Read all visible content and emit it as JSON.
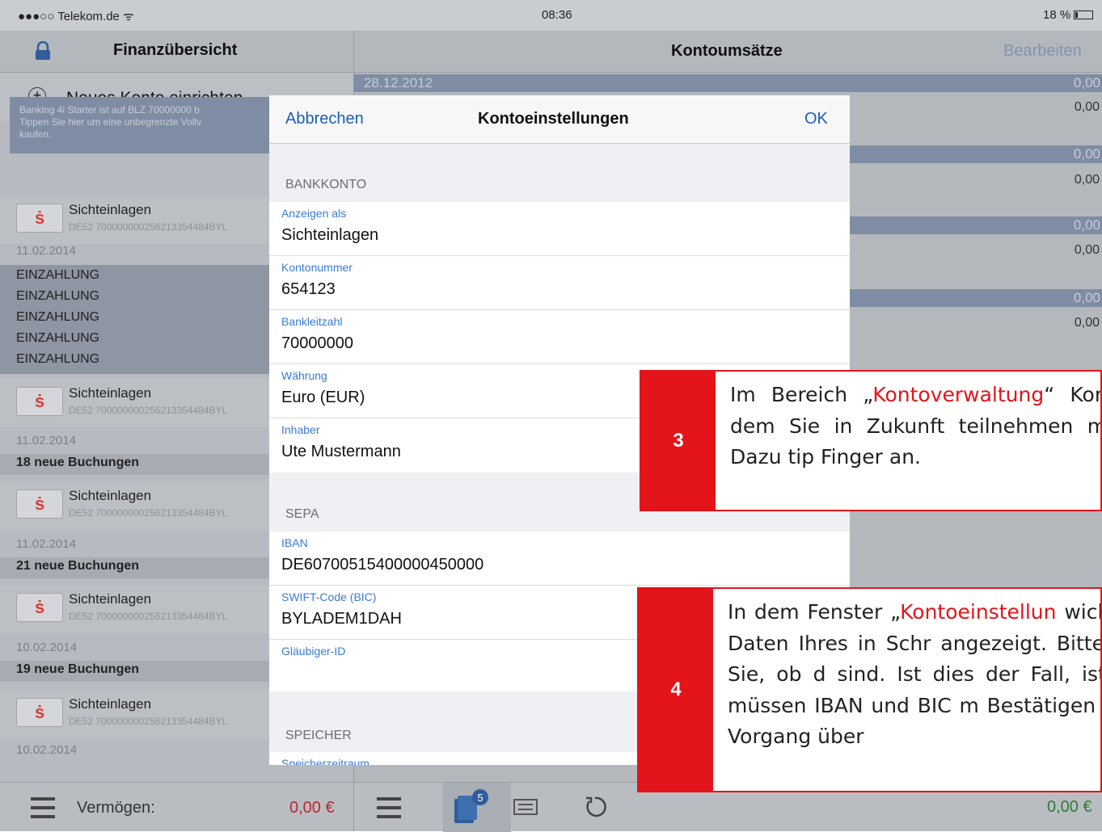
{
  "status_bar": {
    "carrier": "●●●○○ Telekom.de ᯤ",
    "time": "08:36",
    "battery": "18 %"
  },
  "left_pane": {
    "title": "Finanzübersicht",
    "new_account": "Neues Konto einrichten...",
    "banner": {
      "line1": "Banking 4i Starter ist auf BLZ 70000000 b",
      "line2": "Tippen Sie hier um eine unbegrenzte Vollv",
      "line3": "kaufen."
    },
    "accounts": [
      {
        "name": "Sichteinlagen",
        "number": "DE52 700000000256213354484BYL",
        "date": "11.02.2014"
      },
      {
        "name": "Sichteinlagen",
        "number": "DE52 700000000256213354484BYL",
        "date": "11.02.2014"
      },
      {
        "name": "Sichteinlagen",
        "number": "DE52 700000000256213354484BYL",
        "date": "11.02.2014"
      },
      {
        "name": "Sichteinlagen",
        "number": "DE52 700000000256213354484BYL",
        "date": "10.02.2014"
      },
      {
        "name": "Sichteinlagen",
        "number": "DE52 700000000256213354484BYL",
        "date": "10.02.2014"
      }
    ],
    "transactions": [
      "EINZAHLUNG",
      "EINZAHLUNG",
      "EINZAHLUNG",
      "EINZAHLUNG",
      "EINZAHLUNG"
    ],
    "new_bookings": [
      "18 neue Buchungen",
      "21 neue Buchungen",
      "19 neue Buchungen"
    ],
    "footer": {
      "label": "Vermögen:",
      "value": "0,00 €"
    }
  },
  "right_pane": {
    "title": "Kontoumsätze",
    "edit": "Bearbeiten",
    "first_date": "28.12.2012",
    "header_amount": "0,00",
    "amounts": [
      "0,00",
      "0,00",
      "0,00",
      "0,00"
    ],
    "badge": "5",
    "footer_value": "0,00 €"
  },
  "modal": {
    "cancel": "Abbrechen",
    "title": "Kontoeinstellungen",
    "ok": "OK",
    "section_bank": "BANKKONTO",
    "fields_bank": [
      {
        "label": "Anzeigen als",
        "value": "Sichteinlagen"
      },
      {
        "label": "Kontonummer",
        "value": "654123"
      },
      {
        "label": "Bankleitzahl",
        "value": "70000000"
      },
      {
        "label": "Währung",
        "value": "Euro (EUR)"
      },
      {
        "label": "Inhaber",
        "value": "Ute Mustermann"
      }
    ],
    "section_sepa": "SEPA",
    "fields_sepa": [
      {
        "label": "IBAN",
        "value": "DE60700515400000450000"
      },
      {
        "label": "SWIFT-Code (BIC)",
        "value": "BYLADEM1DAH"
      },
      {
        "label": "Gläubiger-ID",
        "value": ""
      }
    ],
    "section_storage": "SPEICHER",
    "storage_partial": "Speicherzeitraum"
  },
  "callouts": [
    {
      "number": "3",
      "text_before": "Im Bereich „",
      "highlight": "Kontoverwaltung",
      "text_after": "“ Konto, mit dem Sie in Zukunft teilnehmen möchten. Dazu tip Finger an."
    },
    {
      "number": "4",
      "text_before": "In dem Fenster „",
      "highlight": "Kontoeinstellun",
      "text_after": " wichtigsten Daten Ihres in Schr angezeigt. Bitte prüfen Sie, ob d sind. Ist dies der Fall, ist Ihr Ko müssen IBAN und BIC m Bestätigen Sie den Vorgang über"
    }
  ],
  "colors": {
    "accent_red": "#e3141a",
    "ios_blue": "#1a5fb4",
    "label_blue": "#3a7bd5",
    "positive_green": "#2e7d32"
  }
}
